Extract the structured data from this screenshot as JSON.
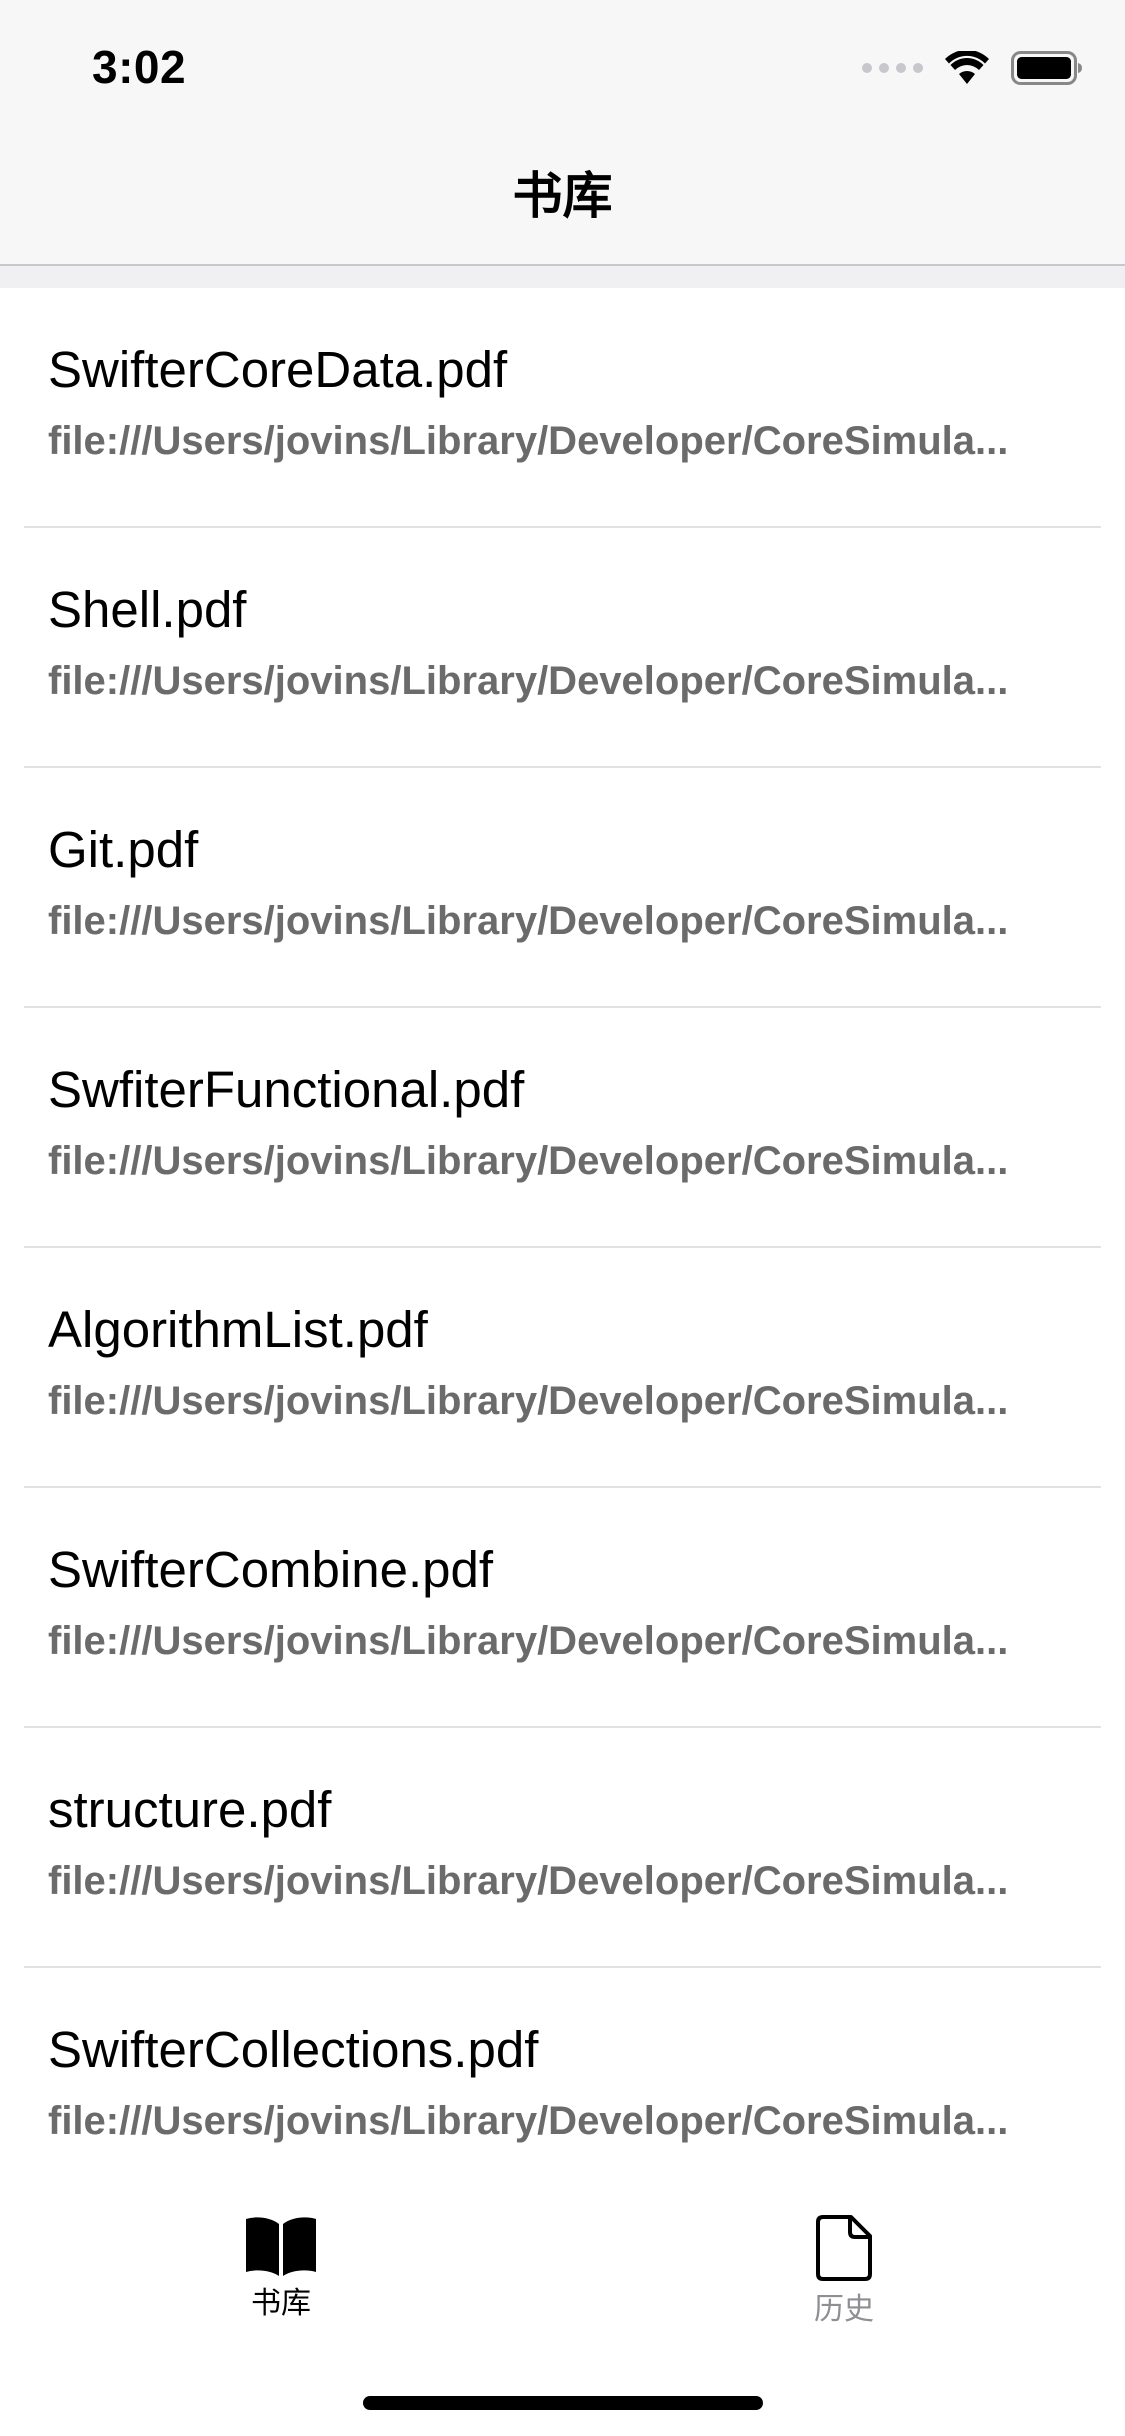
{
  "status_bar": {
    "time": "3:02",
    "icons": [
      "cellular-signal-icon",
      "wifi-icon",
      "battery-icon"
    ]
  },
  "nav": {
    "title": "书库"
  },
  "list": {
    "items": [
      {
        "title": "SwifterCoreData.pdf",
        "subtitle": "file:///Users/jovins/Library/Developer/CoreSimula..."
      },
      {
        "title": "Shell.pdf",
        "subtitle": "file:///Users/jovins/Library/Developer/CoreSimula..."
      },
      {
        "title": "Git.pdf",
        "subtitle": "file:///Users/jovins/Library/Developer/CoreSimula..."
      },
      {
        "title": "SwfiterFunctional.pdf",
        "subtitle": "file:///Users/jovins/Library/Developer/CoreSimula..."
      },
      {
        "title": "AlgorithmList.pdf",
        "subtitle": "file:///Users/jovins/Library/Developer/CoreSimula..."
      },
      {
        "title": "SwifterCombine.pdf",
        "subtitle": "file:///Users/jovins/Library/Developer/CoreSimula..."
      },
      {
        "title": "structure.pdf",
        "subtitle": "file:///Users/jovins/Library/Developer/CoreSimula..."
      },
      {
        "title": "SwifterCollections.pdf",
        "subtitle": "file:///Users/jovins/Library/Developer/CoreSimula..."
      }
    ]
  },
  "tab_bar": {
    "tabs": [
      {
        "label": "书库",
        "icon": "book-icon",
        "selected": true
      },
      {
        "label": "历史",
        "icon": "document-icon",
        "selected": false
      }
    ],
    "colors": {
      "selected": "#000000",
      "unselected": "#8e8e93"
    }
  }
}
